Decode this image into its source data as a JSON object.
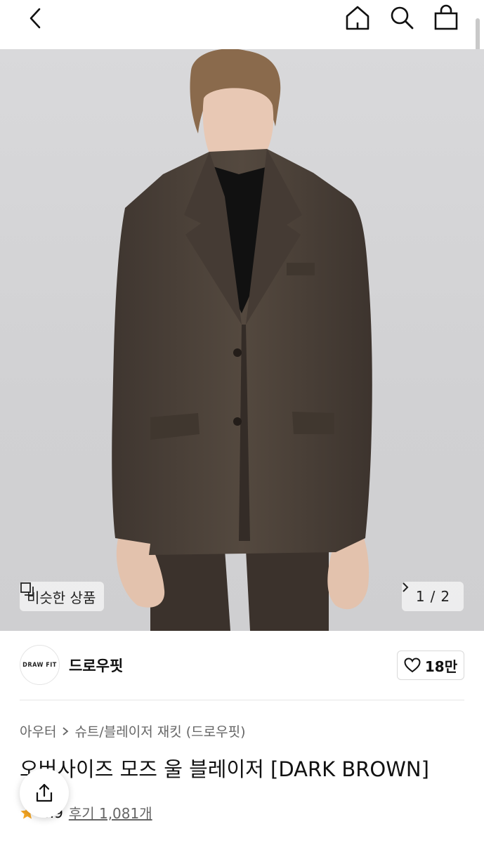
{
  "header": {
    "back_icon": "chevron-left-icon",
    "home_icon": "home-icon",
    "search_icon": "search-icon",
    "bag_icon": "shopping-bag-icon"
  },
  "gallery": {
    "similar_label": "비슷한 상품",
    "similar_icon": "copy-squares-icon",
    "current_page": "1",
    "separator": "/",
    "total_pages": "2"
  },
  "brand": {
    "logo_text": "DRAW FIT",
    "name": "드로우핏",
    "like_count": "18만"
  },
  "product": {
    "breadcrumb": [
      "아우터",
      "슈트/블레이저 재킷 (드로우핏)"
    ],
    "title": "오버사이즈 모즈 울 블레이저 [DARK BROWN]",
    "rating": "4.9",
    "review_label": "후기 1,081개"
  },
  "colors": {
    "accent_star": "#f5a623",
    "jacket": "#4b4139"
  }
}
